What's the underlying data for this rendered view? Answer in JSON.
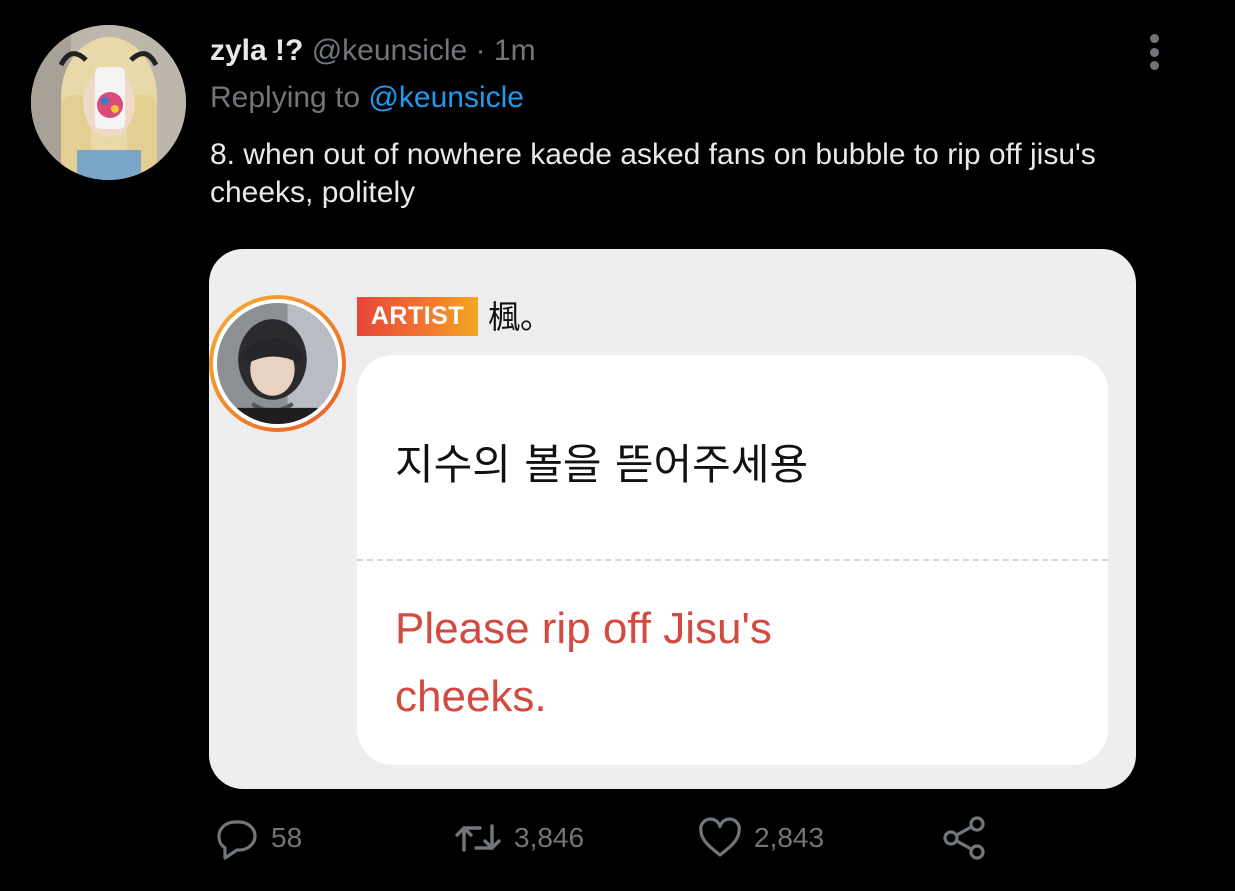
{
  "author": {
    "display_name": "zyla !?",
    "handle": "@keunsicle",
    "separator": "·",
    "timestamp": "1m"
  },
  "reply": {
    "prefix": "Replying to",
    "mention": "@keunsicle"
  },
  "tweet_text": "8. when out of nowhere kaede asked fans on bubble to rip off jisu's cheeks, politely",
  "media": {
    "badge": "ARTIST",
    "artist_name": "楓。",
    "message_korean": "지수의 볼을 뜯어주세용",
    "message_translation": "Please rip off Jisu's cheeks."
  },
  "actions": {
    "replies": "58",
    "retweets": "3,846",
    "likes": "2,843"
  },
  "colors": {
    "background": "#000000",
    "primary_text": "#e7e9ea",
    "secondary_text": "#71767b",
    "mention": "#1d9bf0",
    "translation_red": "#d24a40",
    "badge_orange": "#f07a2f"
  }
}
